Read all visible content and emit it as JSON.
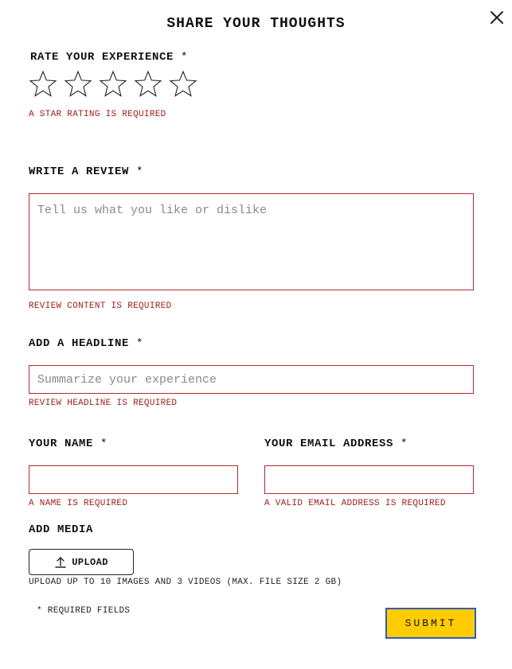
{
  "modal": {
    "title": "SHARE YOUR THOUGHTS",
    "close_icon": "close-icon"
  },
  "rating": {
    "label": "RATE YOUR EXPERIENCE",
    "required_mark": "*",
    "max_stars": 5,
    "selected": 0,
    "error": "A STAR RATING IS REQUIRED"
  },
  "review": {
    "label": "WRITE A REVIEW",
    "required_mark": "*",
    "placeholder": "Tell us what you like or dislike",
    "value": "",
    "error": "REVIEW CONTENT IS REQUIRED"
  },
  "headline": {
    "label": "ADD A HEADLINE",
    "required_mark": "*",
    "placeholder": "Summarize your experience",
    "value": "",
    "error": "REVIEW HEADLINE IS REQUIRED"
  },
  "name": {
    "label": "YOUR NAME",
    "required_mark": "*",
    "value": "",
    "error": "A NAME IS REQUIRED"
  },
  "email": {
    "label": "YOUR EMAIL ADDRESS",
    "required_mark": "*",
    "value": "",
    "error": "A VALID EMAIL ADDRESS IS REQUIRED"
  },
  "media": {
    "label": "ADD MEDIA",
    "upload_label": "UPLOAD",
    "upload_icon": "upload-icon",
    "note": "UPLOAD UP TO 10 IMAGES AND 3 VIDEOS (MAX. FILE SIZE 2 GB)"
  },
  "footer": {
    "required_note": "* REQUIRED FIELDS",
    "submit_label": "SUBMIT"
  },
  "colors": {
    "error": "#a01e1e",
    "field_border": "#b52a2a",
    "submit_bg": "#ffcc00",
    "submit_border": "#2f5bbd"
  }
}
